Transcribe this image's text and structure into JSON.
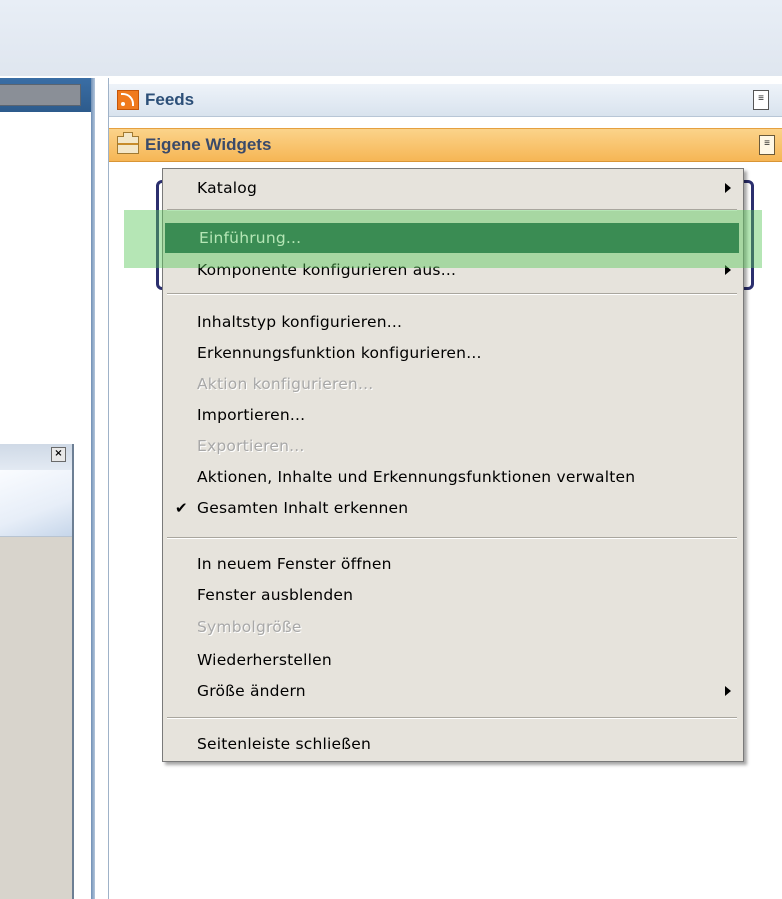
{
  "sidebar": {
    "feeds_title": "Feeds",
    "widgets_title": "Eigene Widgets",
    "menu_glyph": "≡"
  },
  "dialog": {
    "close_glyph": "×"
  },
  "context_menu": {
    "items": [
      {
        "label": "Katalog",
        "submenu": true
      },
      {
        "label": "Einführung...",
        "selected": true
      },
      {
        "label": "Komponente konfigurieren aus...",
        "submenu": true
      },
      {
        "label": "Inhaltstyp konfigurieren..."
      },
      {
        "label": "Erkennungsfunktion konfigurieren..."
      },
      {
        "label": "Aktion konfigurieren...",
        "disabled": true
      },
      {
        "label": "Importieren..."
      },
      {
        "label": "Exportieren...",
        "disabled": true
      },
      {
        "label": "Aktionen, Inhalte und Erkennungsfunktionen verwalten"
      },
      {
        "label": "Gesamten Inhalt erkennen",
        "checked": true
      },
      {
        "label": "In neuem Fenster öffnen"
      },
      {
        "label": "Fenster ausblenden"
      },
      {
        "label": "Symbolgröße",
        "disabled": true
      },
      {
        "label": "Wiederherstellen"
      },
      {
        "label": "Größe ändern",
        "submenu": true
      },
      {
        "label": "Seitenleiste schließen"
      }
    ],
    "check_glyph": "✔"
  },
  "colors": {
    "selection": "#1f5c4e",
    "highlight_overlay": "#5ac85a",
    "widgets_header": "#f6b655",
    "menu_background": "#e6e3dc"
  }
}
